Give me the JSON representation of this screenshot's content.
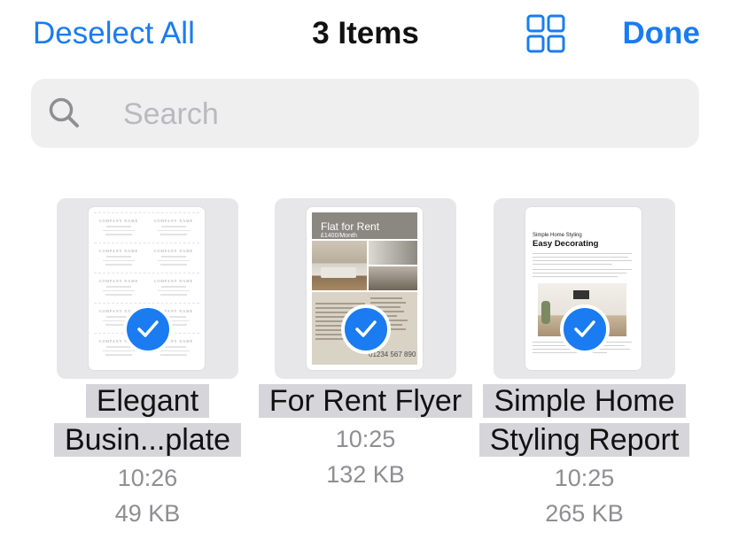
{
  "nav": {
    "deselect_label": "Deselect All",
    "title": "3 Items",
    "done_label": "Done",
    "grid_icon": "grid-view-icon"
  },
  "search": {
    "placeholder": "Search",
    "icon": "search-icon"
  },
  "colors": {
    "accent": "#1a7cf0",
    "secondary_text": "#8e8e93",
    "selection_highlight": "#d6d6da",
    "thumb_background": "#e7e7e9",
    "search_background": "#efeff0"
  },
  "items": [
    {
      "name": "Elegant Busin...plate",
      "time": "10:26",
      "size": "49 KB",
      "selected": true,
      "thumbnail": {
        "card_label": "COMPANY NAME"
      }
    },
    {
      "name": "For Rent Flyer",
      "time": "10:25",
      "size": "132 KB",
      "selected": true,
      "thumbnail": {
        "heading": "Flat for Rent",
        "price": "£1400/Month",
        "phone": "01234 567 890"
      }
    },
    {
      "name": "Simple Home Styling Report",
      "time": "10:25",
      "size": "265 KB",
      "selected": true,
      "thumbnail": {
        "subtitle": "Simple Home Styling",
        "title": "Easy Decorating"
      }
    }
  ]
}
